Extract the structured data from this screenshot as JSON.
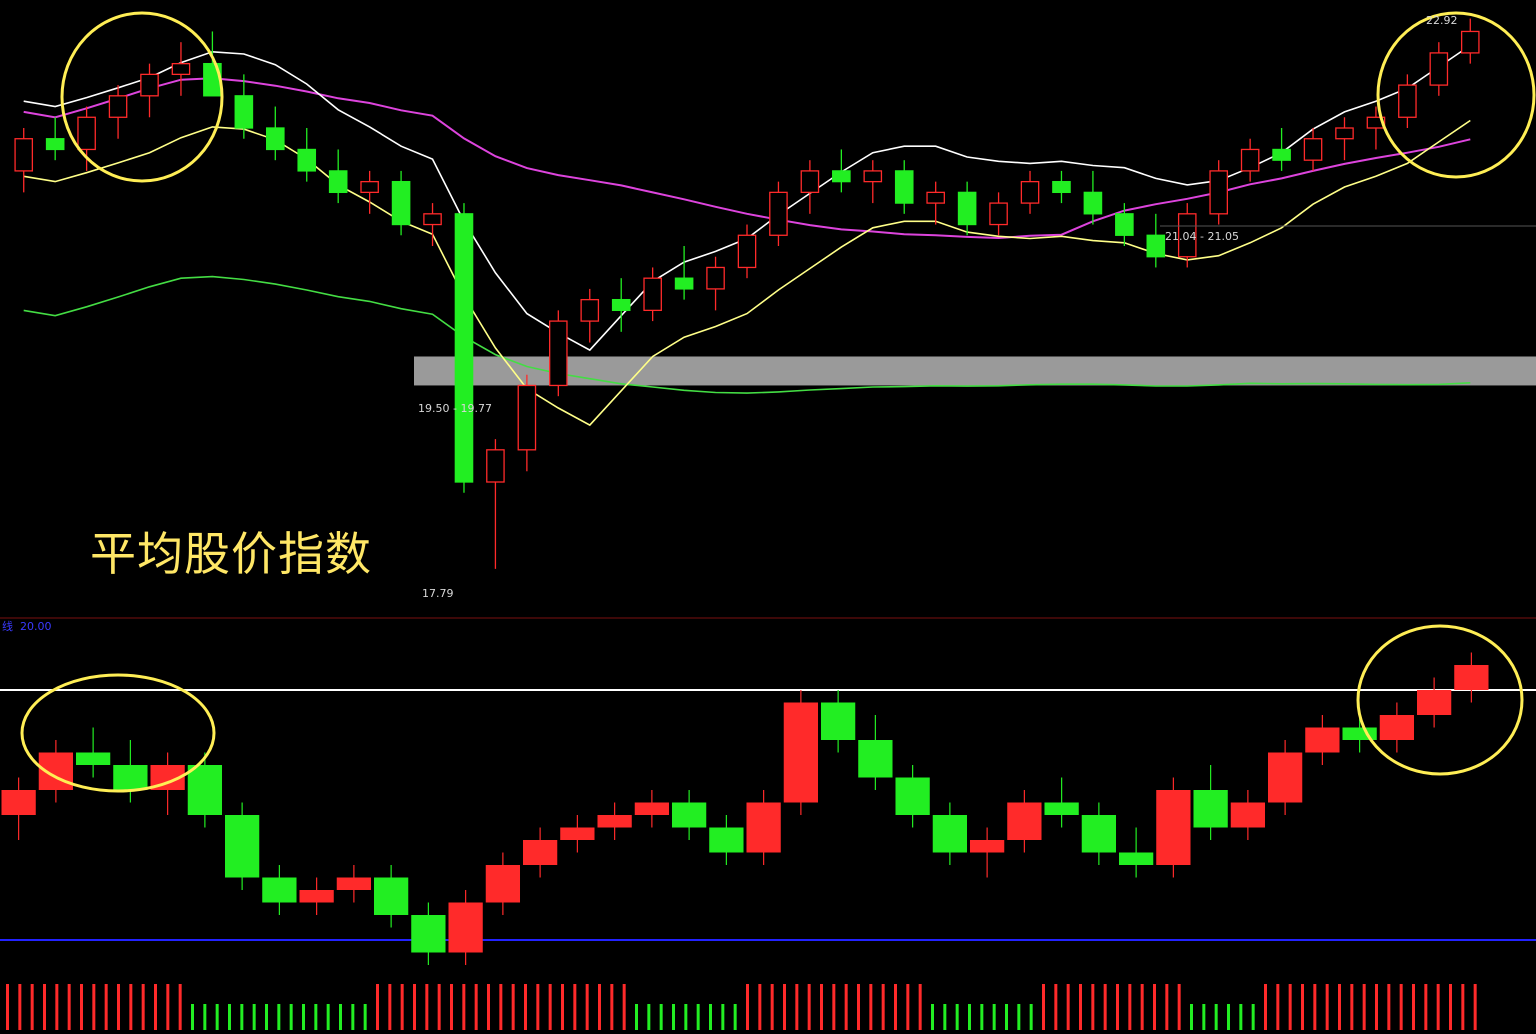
{
  "title": "平均股价指数",
  "labels": {
    "high_price": "22.92",
    "gap_range": "19.50 - 19.77",
    "mid_range": "21.04 - 21.05",
    "low_price": "17.79",
    "lower_panel_tag": "线",
    "lower_panel_value": "20.00"
  },
  "colors": {
    "up": "#ff2a2a",
    "down": "#22ee22",
    "upper_band": "#ffffff",
    "lower_band": "#ffff88",
    "long_ma": "#dd44dd",
    "long_ma_low": "#44dd44",
    "gap_zone": "#9a9a9a",
    "highlight_circle": "#ffee55",
    "ref_high": "#ffffff",
    "ref_low": "#2222ff"
  },
  "chart_data": [
    {
      "type": "candlestick",
      "panel": "price",
      "annotations": [
        "22.92",
        "19.50 - 19.77",
        "21.04 - 21.05",
        "17.79"
      ],
      "gap_zone": {
        "low": 19.5,
        "high": 19.77
      },
      "series": [
        {
          "name": "",
          "kind": "candles",
          "ohlc": [
            [
              21.5,
              21.9,
              21.3,
              21.8
            ],
            [
              21.8,
              22.0,
              21.6,
              21.7
            ],
            [
              21.7,
              22.1,
              21.5,
              22.0
            ],
            [
              22.0,
              22.3,
              21.8,
              22.2
            ],
            [
              22.2,
              22.5,
              22.0,
              22.4
            ],
            [
              22.4,
              22.7,
              22.2,
              22.5
            ],
            [
              22.5,
              22.8,
              22.3,
              22.2
            ],
            [
              22.2,
              22.4,
              21.8,
              21.9
            ],
            [
              21.9,
              22.1,
              21.6,
              21.7
            ],
            [
              21.7,
              21.9,
              21.4,
              21.5
            ],
            [
              21.5,
              21.7,
              21.2,
              21.3
            ],
            [
              21.3,
              21.5,
              21.1,
              21.4
            ],
            [
              21.4,
              21.5,
              20.9,
              21.0
            ],
            [
              21.0,
              21.2,
              20.8,
              21.1
            ],
            [
              21.1,
              21.2,
              18.5,
              18.6
            ],
            [
              18.6,
              19.0,
              17.79,
              18.9
            ],
            [
              18.9,
              19.6,
              18.7,
              19.5
            ],
            [
              19.5,
              20.2,
              19.4,
              20.1
            ],
            [
              20.1,
              20.4,
              19.9,
              20.3
            ],
            [
              20.3,
              20.5,
              20.0,
              20.2
            ],
            [
              20.2,
              20.6,
              20.1,
              20.5
            ],
            [
              20.5,
              20.8,
              20.3,
              20.4
            ],
            [
              20.4,
              20.7,
              20.2,
              20.6
            ],
            [
              20.6,
              21.0,
              20.5,
              20.9
            ],
            [
              20.9,
              21.4,
              20.8,
              21.3
            ],
            [
              21.3,
              21.6,
              21.1,
              21.5
            ],
            [
              21.5,
              21.7,
              21.3,
              21.4
            ],
            [
              21.4,
              21.6,
              21.2,
              21.5
            ],
            [
              21.5,
              21.6,
              21.1,
              21.2
            ],
            [
              21.2,
              21.4,
              21.0,
              21.3
            ],
            [
              21.3,
              21.4,
              20.9,
              21.0
            ],
            [
              21.0,
              21.3,
              20.9,
              21.2
            ],
            [
              21.2,
              21.5,
              21.1,
              21.4
            ],
            [
              21.4,
              21.5,
              21.2,
              21.3
            ],
            [
              21.3,
              21.5,
              21.0,
              21.1
            ],
            [
              21.1,
              21.2,
              20.8,
              20.9
            ],
            [
              20.9,
              21.1,
              20.6,
              20.7
            ],
            [
              20.7,
              21.2,
              20.6,
              21.1
            ],
            [
              21.1,
              21.6,
              21.0,
              21.5
            ],
            [
              21.5,
              21.8,
              21.4,
              21.7
            ],
            [
              21.7,
              21.9,
              21.5,
              21.6
            ],
            [
              21.6,
              21.9,
              21.5,
              21.8
            ],
            [
              21.8,
              22.0,
              21.6,
              21.9
            ],
            [
              21.9,
              22.1,
              21.7,
              22.0
            ],
            [
              22.0,
              22.4,
              21.9,
              22.3
            ],
            [
              22.3,
              22.7,
              22.2,
              22.6
            ],
            [
              22.6,
              22.92,
              22.5,
              22.8
            ]
          ]
        },
        {
          "name": "",
          "kind": "line",
          "color_key": "upper_band"
        },
        {
          "name": "",
          "kind": "line",
          "color_key": "lower_band"
        },
        {
          "name": "",
          "kind": "line",
          "color_key": "long_ma"
        },
        {
          "name": "",
          "kind": "line",
          "color_key": "long_ma_low"
        }
      ]
    },
    {
      "type": "bar",
      "panel": "indicator",
      "label": "线 20.00",
      "reference_lines": [
        {
          "value": 20.0,
          "color_key": "ref_high"
        },
        {
          "value": 0.0,
          "color_key": "ref_low"
        }
      ],
      "series": [
        {
          "name": "",
          "kind": "candles",
          "ohlc": [
            [
              10,
              13,
              8,
              12
            ],
            [
              12,
              16,
              11,
              15
            ],
            [
              15,
              17,
              13,
              14
            ],
            [
              14,
              16,
              11,
              12
            ],
            [
              12,
              15,
              10,
              14
            ],
            [
              14,
              15,
              9,
              10
            ],
            [
              10,
              11,
              4,
              5
            ],
            [
              5,
              6,
              2,
              3
            ],
            [
              3,
              5,
              2,
              4
            ],
            [
              4,
              6,
              3,
              5
            ],
            [
              5,
              6,
              1,
              2
            ],
            [
              2,
              3,
              -2,
              -1
            ],
            [
              -1,
              4,
              -2,
              3
            ],
            [
              3,
              7,
              2,
              6
            ],
            [
              6,
              9,
              5,
              8
            ],
            [
              8,
              10,
              7,
              9
            ],
            [
              9,
              11,
              8,
              10
            ],
            [
              10,
              12,
              9,
              11
            ],
            [
              11,
              12,
              8,
              9
            ],
            [
              9,
              10,
              6,
              7
            ],
            [
              7,
              12,
              6,
              11
            ],
            [
              11,
              20,
              10,
              19
            ],
            [
              19,
              20,
              15,
              16
            ],
            [
              16,
              18,
              12,
              13
            ],
            [
              13,
              14,
              9,
              10
            ],
            [
              10,
              11,
              6,
              7
            ],
            [
              7,
              9,
              5,
              8
            ],
            [
              8,
              12,
              7,
              11
            ],
            [
              11,
              13,
              9,
              10
            ],
            [
              10,
              11,
              6,
              7
            ],
            [
              7,
              9,
              5,
              6
            ],
            [
              6,
              13,
              5,
              12
            ],
            [
              12,
              14,
              8,
              9
            ],
            [
              9,
              12,
              8,
              11
            ],
            [
              11,
              16,
              10,
              15
            ],
            [
              15,
              18,
              14,
              17
            ],
            [
              17,
              18,
              15,
              16
            ],
            [
              16,
              19,
              15,
              18
            ],
            [
              18,
              21,
              17,
              20
            ],
            [
              20,
              23,
              19,
              22
            ]
          ]
        },
        {
          "name": "",
          "kind": "histogram",
          "signs": [
            1,
            1,
            1,
            1,
            1,
            -1,
            -1,
            -1,
            -1,
            -1,
            1,
            1,
            1,
            1,
            1,
            1,
            1,
            -1,
            -1,
            -1,
            1,
            1,
            1,
            1,
            1,
            -1,
            -1,
            -1,
            1,
            1,
            1,
            1,
            -1,
            -1,
            1,
            1,
            1,
            1,
            1,
            1
          ]
        }
      ]
    }
  ]
}
